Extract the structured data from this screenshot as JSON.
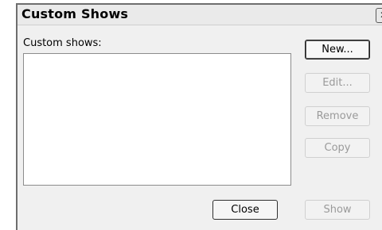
{
  "window": {
    "title": "Custom Shows",
    "close_glyph": "✕"
  },
  "list": {
    "label": "Custom shows:",
    "items": []
  },
  "buttons": {
    "new": "New...",
    "edit": "Edit...",
    "remove": "Remove",
    "copy": "Copy",
    "close": "Close",
    "show": "Show"
  },
  "icons": {
    "close": "close-icon"
  }
}
